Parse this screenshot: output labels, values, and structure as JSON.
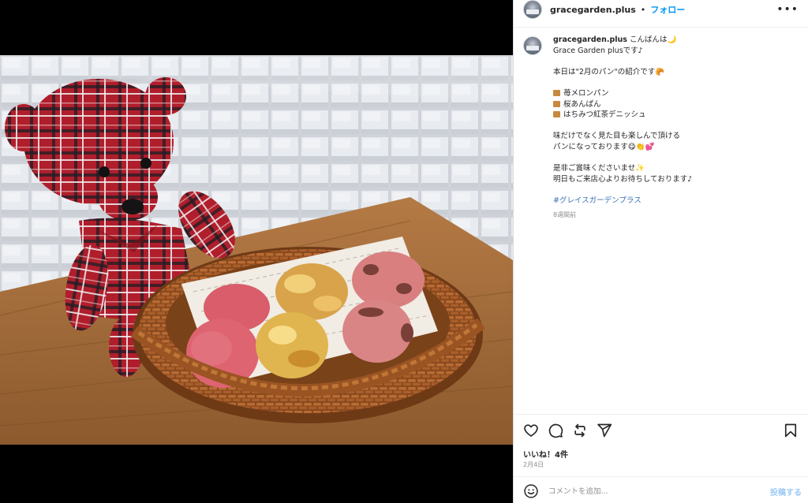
{
  "post": {
    "username": "gracegarden.plus",
    "separator": "•",
    "follow_label": "フォロー",
    "more_label": "•••"
  },
  "caption": {
    "username": "gracegarden.plus",
    "line1": "こんばんは🌙",
    "line2": "Grace Garden plusです♪",
    "line3": "本日は\"2月のパン\"の紹介です🥐",
    "item1": "苺メロンパン",
    "item2": "桜あんぱん",
    "item3": "はちみつ紅茶デニッシュ",
    "line4": "味だけでなく見た目も楽しんで頂ける",
    "line5": "パンになっております😋👏💕",
    "line6": "是非ご賞味くださいませ✨",
    "line7": "明日もご来店心よりお待ちしております♪",
    "hashtag": "#グレイスガーデンプラス",
    "time": "8週間前"
  },
  "footer": {
    "likes": "いいね！4件",
    "date": "2月4日",
    "comment_placeholder": "コメントを追加...",
    "post_label": "投稿する"
  },
  "icons": {
    "like": "heart-icon",
    "comment": "comment-icon",
    "share": "repost-icon",
    "send": "send-icon",
    "save": "bookmark-icon",
    "emoji": "smile-icon"
  },
  "colors": {
    "follow_blue": "#0095f6",
    "hashtag": "#3b73b9",
    "muted_text": "#8e8e8e",
    "post_disabled": "#9cc9f5"
  }
}
